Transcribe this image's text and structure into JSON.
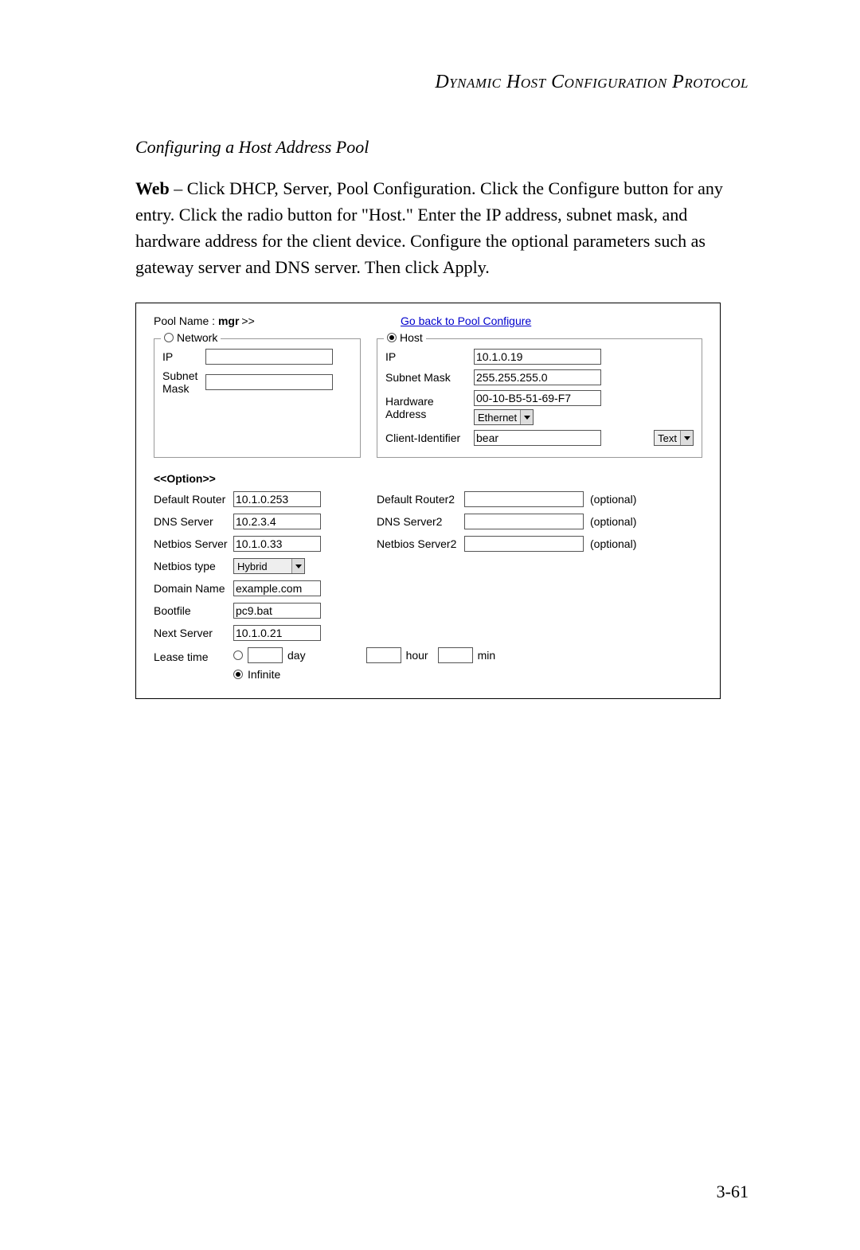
{
  "header": {
    "title": "Dynamic Host Configuration Protocol"
  },
  "section": {
    "subtitle": "Configuring a Host Address Pool"
  },
  "body": {
    "web_label": "Web",
    "paragraph": " – Click DHCP, Server, Pool Configuration. Click the Configure button for any entry. Click the radio button for \"Host.\" Enter the IP address, subnet mask, and hardware address for the client device. Configure the optional parameters such as gateway server and DNS server. Then click Apply."
  },
  "panel": {
    "pool_name_label": "Pool Name : ",
    "pool_name_value": "mgr",
    "pool_name_suffix": ">>",
    "back_link": "Go back to Pool Configure",
    "network": {
      "legend": "Network",
      "selected": false,
      "ip_label": "IP",
      "ip": "",
      "subnet_label": "Subnet Mask",
      "subnet": ""
    },
    "host": {
      "legend": "Host",
      "selected": true,
      "ip_label": "IP",
      "ip": "10.1.0.19",
      "subnet_label": "Subnet Mask",
      "subnet": "255.255.255.0",
      "hw_label": "Hardware Address",
      "hw": "00-10-B5-51-69-F7",
      "hw_type": "Ethernet",
      "client_id_label": "Client-Identifier",
      "client_id": "bear",
      "client_id_type": "Text"
    },
    "option": {
      "header": "<<Option>>",
      "default_router_label": "Default Router",
      "default_router": "10.1.0.253",
      "default_router2_label": "Default Router2",
      "default_router2": "",
      "dns_label": "DNS Server",
      "dns": "10.2.3.4",
      "dns2_label": "DNS Server2",
      "dns2": "",
      "netbios_label": "Netbios Server",
      "netbios": "10.1.0.33",
      "netbios2_label": "Netbios Server2",
      "netbios2": "",
      "netbios_type_label": "Netbios type",
      "netbios_type": "Hybrid",
      "domain_label": "Domain Name",
      "domain": "example.com",
      "bootfile_label": "Bootfile",
      "bootfile": "pc9.bat",
      "next_server_label": "Next Server",
      "next_server": "10.1.0.21",
      "lease_label": "Lease time",
      "lease_day": "",
      "lease_day_unit": "day",
      "lease_hour": "",
      "lease_hour_unit": "hour",
      "lease_min": "",
      "lease_min_unit": "min",
      "lease_infinite_label": "Infinite",
      "lease_infinite": true,
      "optional_hint": "(optional)"
    }
  },
  "footer": {
    "page": "3-61"
  }
}
